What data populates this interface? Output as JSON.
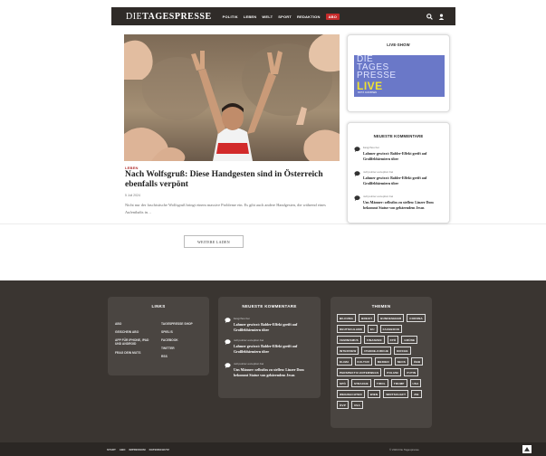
{
  "header": {
    "logo_light": "DIE",
    "logo_bold": "TAGESPRESSE",
    "nav": [
      "POLITIK",
      "LEBEN",
      "WELT",
      "SPORT",
      "REDAKTION"
    ],
    "abo": "ABO"
  },
  "article": {
    "category": "LEBEN",
    "title": "Nach Wolfsgruß: Diese Handgesten sind in Österreich ebenfalls verpönt",
    "date": "5 Juli 2024",
    "teaser": "Nicht nur der faschistische Wolfsgruß bringt einem massive Probleme ein. Es gibt auch andere Handgesten, die während eines Aufenthalts in…"
  },
  "more_button": "WEITERE LADEN",
  "live": {
    "title": "LIVE-SHOW",
    "lines": [
      "DIE",
      "TAGES",
      "PRESSE",
      "LIVE"
    ],
    "small": "FRITZ JAKOBSEN"
  },
  "comments": {
    "title": "NEUESTE KOMMENTARE",
    "items": [
      {
        "who": "liangzhou bei",
        "text": "Lahmer gewixxt: Babler-Effekt greift auf Großfeldsiemiern über"
      },
      {
        "who": "null pointer exception bei",
        "text": "Lahmer gewixxt: Babler-Effekt greift auf Großfeldsiemiern über"
      },
      {
        "who": "null pointer exception bei",
        "text": "Uns Männer: selbstlos zu stellen: Linzer Dom bekommt Statue von gebärendem Jesus"
      }
    ]
  },
  "footer": {
    "links_title": "LINKS",
    "links_col1": [
      "ABO",
      "GEISCHEIN ABO",
      "APP FÜR IPHONE, IPAD UND ANDROID",
      "FRAG DEIN MUTS"
    ],
    "links_col2": [
      "TAGESPRESSE SHOP",
      "SPIEL!S",
      "FACEBOOK",
      "TWITTER",
      "RSS"
    ],
    "comments_title": "NEUESTE KOMMENTARE",
    "themes_title": "THEMEN",
    "tags": [
      "BILDUNG",
      "BREXIT",
      "BUNDESHEER",
      "CORONA",
      "DEUTSCHLAND",
      "EU",
      "FACEBOOK",
      "FEMINISMUS",
      "FINANZEN",
      "FPÖ",
      "GRÜNE",
      "INTERVIEW",
      "IPHONE-KIRCHE",
      "KIRCHE",
      "KLIMA",
      "KULTUR",
      "MEDIEN",
      "NEOS",
      "ÖBB",
      "PERSPEKTIV-UNTERWEGS",
      "POLIZEI",
      "PUTIN",
      "SPÖ",
      "STRACHE",
      "TIROL",
      "TRUMP",
      "USA",
      "WEIHNACHTEN",
      "WIEN",
      "WIRTSCHAFT",
      "ZIB",
      "ÖVP",
      "USA"
    ],
    "bottom_links": [
      "START",
      "ABO",
      "IMPRESSUM",
      "DATENSCHUTZ"
    ],
    "copyright": "© 2024 Die Tagespresse"
  }
}
